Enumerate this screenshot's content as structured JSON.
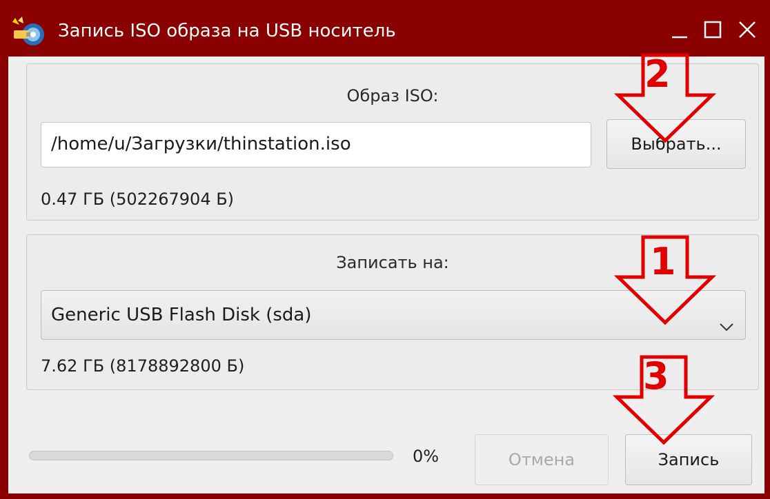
{
  "window": {
    "title": "Запись ISO образа на USB носитель",
    "accent": "#8a0000"
  },
  "iso_group": {
    "title": "Образ ISO:",
    "path_value": "/home/u/Загрузки/thinstation.iso",
    "browse_label": "Выбрать...",
    "size_info": "0.47 ГБ (502267904 Б)"
  },
  "target_group": {
    "title": "Записать на:",
    "selected_device": "Generic USB Flash Disk (sda)",
    "size_info": "7.62 ГБ (8178892800 Б)"
  },
  "footer": {
    "progress_percent": 0,
    "progress_text": "0%",
    "cancel_label": "Отмена",
    "write_label": "Запись"
  },
  "annotations": {
    "arrow_1_label": "1",
    "arrow_2_label": "2",
    "arrow_3_label": "3",
    "arrow_color": "#e00000"
  },
  "icons": [
    "app-icon",
    "minimize-icon",
    "maximize-icon",
    "close-icon",
    "chevron-down-icon"
  ]
}
